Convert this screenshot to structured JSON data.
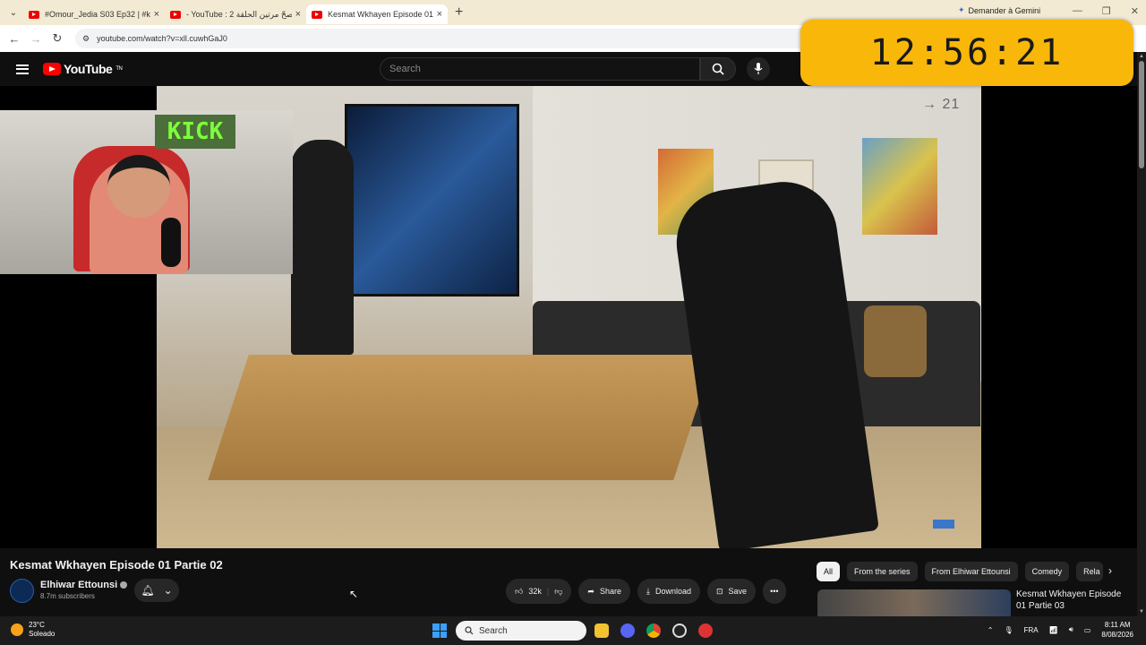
{
  "browser": {
    "tabs": [
      {
        "title": "#Omour_Jedia S03 Ep32 | #khar",
        "active": false
      },
      {
        "title": "- YouTube : 2 صحّ مرتين الحلقة",
        "active": false
      },
      {
        "title": "Kesmat Wkhayen Episode 01",
        "active": true
      }
    ],
    "new_tab": "+",
    "gemini_button": "Demander à Gemini",
    "url": "youtube.com/watch?v=xll.cuwhGaJ0"
  },
  "youtube": {
    "logo_text": "YouTube",
    "logo_sup": "TN",
    "search_placeholder": "Search"
  },
  "overlay": {
    "clock": "12:56:21",
    "webcam_sign": "KICK",
    "video_corner_text": "→ 21"
  },
  "video": {
    "title": "Kesmat Wkhayen Episode 01 Partie 02",
    "channel": "Elhiwar Ettounsi",
    "subscribers": "8.7m subscribers",
    "likes": "32k",
    "share_label": "Share",
    "download_label": "Download",
    "save_label": "Save",
    "more_label": "•••"
  },
  "chips": [
    "All",
    "From the series",
    "From Elhiwar Ettounsi",
    "Comedy",
    "Rela"
  ],
  "recommendation": {
    "title": "Kesmat Wkhayen Episode 01 Partie 03"
  },
  "taskbar": {
    "temp": "23°C",
    "weather": "Soleado",
    "search_label": "Search",
    "lang": "FRA",
    "time": "8:11 AM",
    "date": "8/08/2026"
  },
  "colors": {
    "clock_bg": "#f9b70a",
    "yt_red": "#ff0000",
    "tab_bar": "#f2ead3"
  }
}
